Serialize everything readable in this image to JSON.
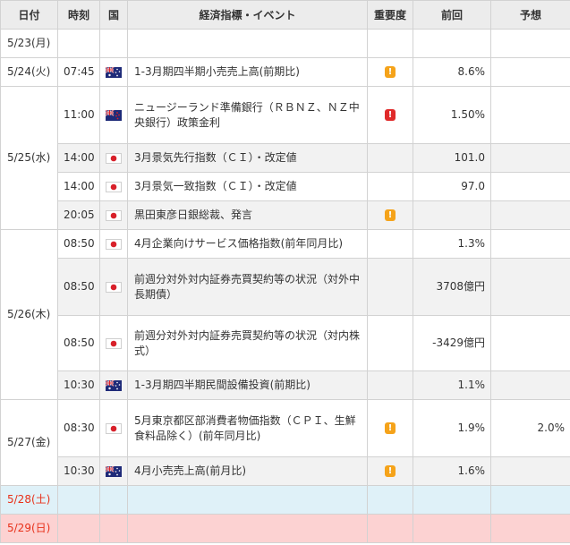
{
  "header": {
    "date": "日付",
    "time": "時刻",
    "country": "国",
    "event": "経済指標・イベント",
    "importance": "重要度",
    "previous": "前回",
    "forecast": "予想"
  },
  "days": [
    {
      "date": "5/23(月)",
      "style": "normal",
      "events": []
    },
    {
      "date": "5/24(火)",
      "style": "normal",
      "events": [
        {
          "time": "07:45",
          "country": "au",
          "name": "1-3月期四半期小売売上高(前期比)",
          "importance": "mid",
          "previous": "8.6%",
          "forecast": ""
        }
      ]
    },
    {
      "date": "5/25(水)",
      "style": "normal",
      "events": [
        {
          "time": "11:00",
          "country": "nz",
          "name": "ニュージーランド準備銀行（ＲＢＮＺ、ＮＺ中央銀行）政策金利",
          "importance": "high",
          "previous": "1.50%",
          "forecast": ""
        },
        {
          "time": "14:00",
          "country": "jp",
          "name": "3月景気先行指数（ＣＩ）・改定値",
          "importance": "",
          "previous": "101.0",
          "forecast": ""
        },
        {
          "time": "14:00",
          "country": "jp",
          "name": "3月景気一致指数（ＣＩ）・改定値",
          "importance": "",
          "previous": "97.0",
          "forecast": ""
        },
        {
          "time": "20:05",
          "country": "jp",
          "name": "黒田東彦日銀総裁、発言",
          "importance": "mid",
          "previous": "",
          "forecast": ""
        }
      ]
    },
    {
      "date": "5/26(木)",
      "style": "normal",
      "events": [
        {
          "time": "08:50",
          "country": "jp",
          "name": "4月企業向けサービス価格指数(前年同月比)",
          "importance": "",
          "previous": "1.3%",
          "forecast": ""
        },
        {
          "time": "08:50",
          "country": "jp",
          "name": "前週分対外対内証券売買契約等の状況（対外中長期債）",
          "importance": "",
          "previous": "3708億円",
          "forecast": ""
        },
        {
          "time": "08:50",
          "country": "jp",
          "name": "前週分対外対内証券売買契約等の状況（対内株式）",
          "importance": "",
          "previous": "-3429億円",
          "forecast": ""
        },
        {
          "time": "10:30",
          "country": "au",
          "name": "1-3月期四半期民間設備投資(前期比)",
          "importance": "",
          "previous": "1.1%",
          "forecast": ""
        }
      ]
    },
    {
      "date": "5/27(金)",
      "style": "normal",
      "events": [
        {
          "time": "08:30",
          "country": "jp",
          "name": "5月東京都区部消費者物価指数（ＣＰＩ、生鮮食料品除く）(前年同月比)",
          "importance": "mid",
          "previous": "1.9%",
          "forecast": "2.0%"
        },
        {
          "time": "10:30",
          "country": "au",
          "name": "4月小売売上高(前月比)",
          "importance": "mid",
          "previous": "1.6%",
          "forecast": ""
        }
      ]
    },
    {
      "date": "5/28(土)",
      "style": "sat",
      "events": []
    },
    {
      "date": "5/29(日)",
      "style": "sun",
      "events": []
    }
  ],
  "icons": {
    "au": "australia-flag-icon",
    "nz": "new-zealand-flag-icon",
    "jp": "japan-flag-icon"
  },
  "importance_glyph": "!",
  "colors": {
    "header_bg": "#ececec",
    "alt_row": "#f2f2f2",
    "saturday_bg": "#dff1f8",
    "sunday_bg": "#fcd2d2",
    "weekend_text": "#e8311a",
    "importance_mid": "#f5a31a",
    "importance_high": "#e02a2a"
  }
}
